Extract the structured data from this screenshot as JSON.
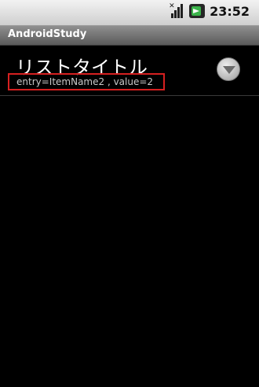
{
  "statusbar": {
    "time": "23:52",
    "icons": [
      "signal-icon",
      "battery-icon"
    ]
  },
  "titlebar": {
    "title": "AndroidStudy"
  },
  "list": {
    "items": [
      {
        "title": "リストタイトル",
        "subtitle": "entry=ItemName2 , value=2",
        "action_icon": "chevron-down-icon"
      }
    ]
  },
  "colors": {
    "background": "#000000",
    "highlight_border": "#d62020",
    "statusbar": "#d9d9d9",
    "titlebar": "#6e6e6e"
  }
}
